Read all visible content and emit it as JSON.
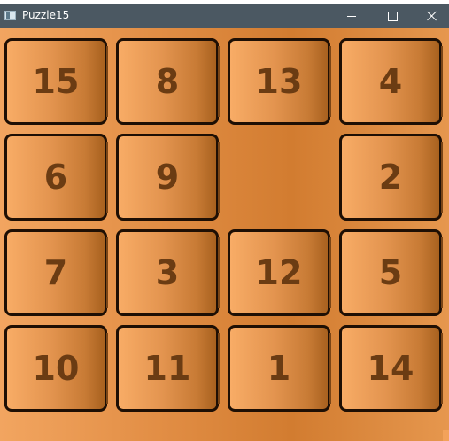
{
  "window": {
    "title": "Puzzle15",
    "icon": "app-window-icon",
    "controls": [
      "minimize-icon",
      "maximize-icon",
      "close-icon"
    ]
  },
  "board": {
    "rows": 4,
    "cols": 4,
    "tiles": [
      [
        "15",
        "8",
        "13",
        "4"
      ],
      [
        "6",
        "9",
        "",
        "2"
      ],
      [
        "7",
        "3",
        "12",
        "5"
      ],
      [
        "10",
        "11",
        "1",
        "14"
      ]
    ]
  },
  "colors": {
    "titlebar": "#4b5862",
    "board_background": "#e28e45",
    "tile_text": "#6b3c13",
    "tile_border": "#1e0f04"
  }
}
